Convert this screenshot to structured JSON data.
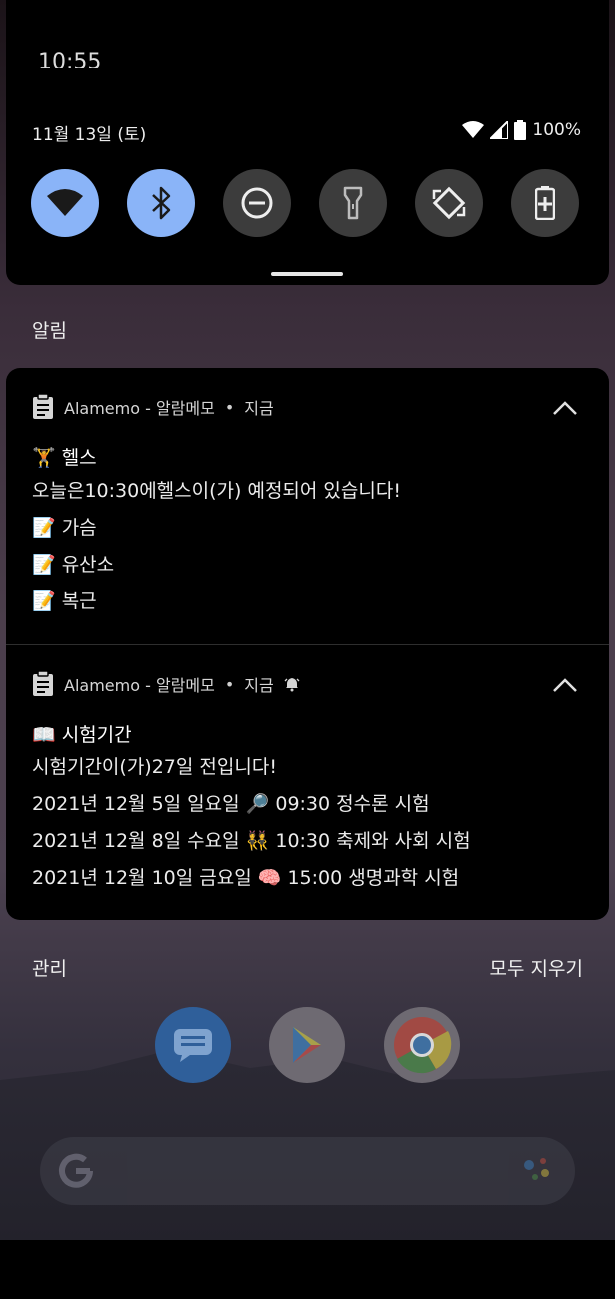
{
  "status_bar": {
    "clock": "10:55",
    "date": "11월 13일 (토)",
    "battery": "100%"
  },
  "quick_settings": {
    "tiles": [
      {
        "icon": "wifi-icon",
        "active": true
      },
      {
        "icon": "bluetooth-icon",
        "active": true
      },
      {
        "icon": "do-not-disturb-icon",
        "active": false
      },
      {
        "icon": "flashlight-icon",
        "active": false
      },
      {
        "icon": "auto-rotate-icon",
        "active": false
      },
      {
        "icon": "battery-saver-icon",
        "active": false
      }
    ]
  },
  "notifications_title": "알림",
  "notifications": [
    {
      "app": "Alamemo - 알람메모",
      "time": "지금",
      "title": "🏋 헬스",
      "lines": [
        "오늘은10:30에헬스이(가) 예정되어 있습니다!",
        "📝 가슴",
        "📝 유산소",
        "📝 복근"
      ]
    },
    {
      "app": "Alamemo - 알람메모",
      "time": "지금",
      "title": "📖 시험기간",
      "lines": [
        "시험기간이(가)27일 전입니다!",
        "2021년 12월 5일 일요일 🔎 09:30 정수론 시험",
        "2021년 12월 8일 수요일 👯 10:30 축제와 사회 시험",
        "2021년 12월 10일 금요일 🧠 15:00 생명과학 시험"
      ]
    }
  ],
  "footer": {
    "manage": "관리",
    "clear_all": "모두 지우기"
  },
  "colors": {
    "tile_active": "#8ab4f8",
    "tile_inactive": "#3c3c3c"
  }
}
